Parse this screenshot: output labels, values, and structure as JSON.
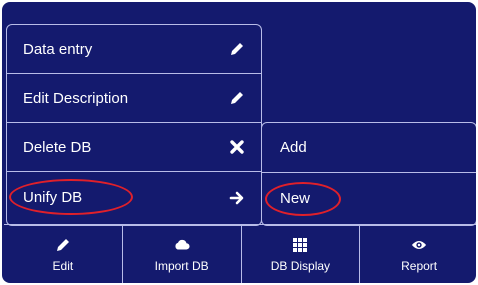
{
  "menu": {
    "items": [
      {
        "label": "Data entry",
        "icon": "pencil-icon"
      },
      {
        "label": "Edit Description",
        "icon": "pencil-icon"
      },
      {
        "label": "Delete DB",
        "icon": "close-icon"
      },
      {
        "label": "Unify DB",
        "icon": "arrow-right-icon",
        "highlighted": true
      }
    ]
  },
  "submenu": {
    "items": [
      {
        "label": "Add"
      },
      {
        "label": "New",
        "highlighted": true
      }
    ]
  },
  "toolbar": {
    "items": [
      {
        "label": "Edit",
        "icon": "pencil-icon"
      },
      {
        "label": "Import DB",
        "icon": "cloud-icon"
      },
      {
        "label": "DB Display",
        "icon": "grid-icon"
      },
      {
        "label": "Report",
        "icon": "eye-icon"
      }
    ]
  },
  "colors": {
    "background": "#141a6e",
    "border": "#b8bce8",
    "text": "#ffffff",
    "highlight_ring": "#e0202a"
  }
}
